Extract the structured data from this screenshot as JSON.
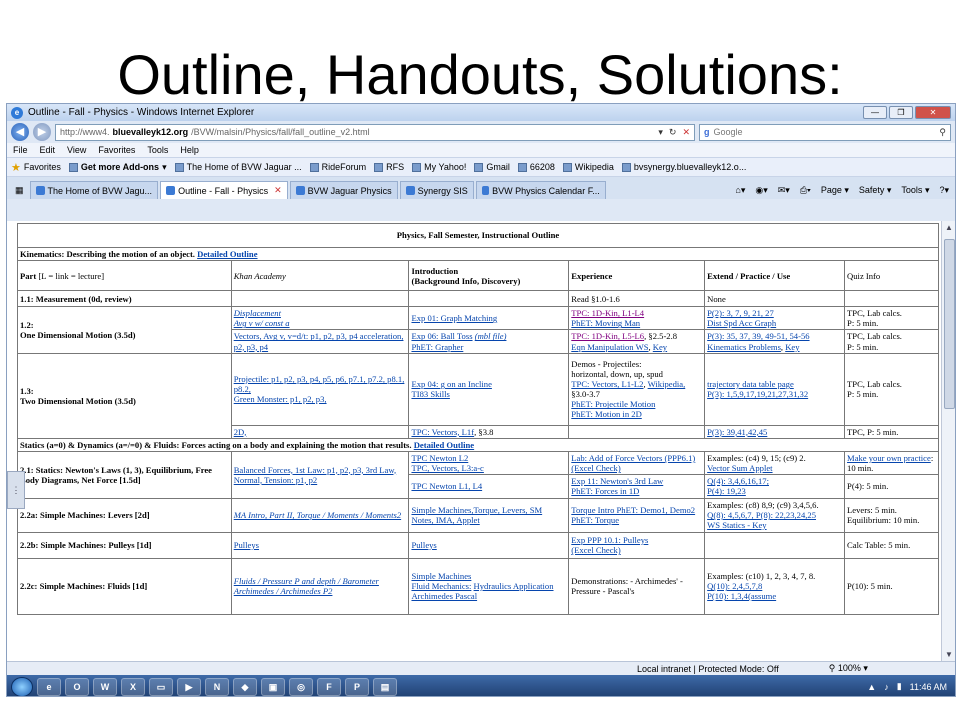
{
  "slide": {
    "title": "Outline, Handouts, Solutions:"
  },
  "window": {
    "title": "Outline - Fall - Physics - Windows Internet Explorer"
  },
  "address": {
    "url_prefix": "http://www4.",
    "url_domain": "bluevalleyk12.org",
    "url_path": "/BVW/malsin/Physics/fall/fall_outline_v2.html",
    "search_placeholder": "Google"
  },
  "menu": [
    "File",
    "Edit",
    "View",
    "Favorites",
    "Tools",
    "Help"
  ],
  "favorites": [
    "Favorites",
    "Get more Add-ons",
    "The Home of BVW Jaguar ...",
    "RideForum",
    "RFS",
    "My Yahoo!",
    "Gmail",
    "66208",
    "Wikipedia",
    "bvsynergy.bluevalleyk12.o..."
  ],
  "tabs": [
    "The Home of BVW Jagu...",
    "Outline - Fall - Physics",
    "BVW Jaguar Physics",
    "Synergy SIS",
    "BVW Physics Calendar F..."
  ],
  "toolbar": [
    "Page",
    "Safety",
    "Tools"
  ],
  "table": {
    "title": "Physics, Fall Semester, Instructional Outline",
    "kinematics_head": "Kinematics: Describing the motion of an object.",
    "detailed_outline": "Detailed Outline",
    "part": "Part",
    "part_note": "[L = link = lecture]",
    "khan": "Khan Academy",
    "intro": "Introduction",
    "intro_sub": "(Background Info, Discovery)",
    "experience": "Experience",
    "extend": "Extend / Practice / Use",
    "quiz": "Quiz Info",
    "r11_part": "1.1: Measurement (0d, review)",
    "r11_exp": "Read §1.0-1.6",
    "r11_ext": "None",
    "r12_part_a": "1.2:",
    "r12_part_b": "One Dimensional Motion (3.5d)",
    "r12_khan_1": "Displacement",
    "r12_khan_2": "Avg v w/ const a",
    "r12_intro_1": "Exp 01: Graph Matching",
    "r12_exp_1a": "TPC: 1D-Kin, L1-L4",
    "r12_exp_1b": "PhET: Moving Man",
    "r12_ext_1a": "P(2): 3, 7, 9, 21, 27",
    "r12_ext_1b": "Dist Spd Acc Graph",
    "r12_quiz_1a": "TPC, Lab calcs.",
    "r12_quiz_1b": "P: 5 min.",
    "r12_khan_3": "Vectors, Avg v, v=d/t: p1, p2, p3, p4 acceleration, p2, p3, p4",
    "r12_intro_2a": "Exp 06: Ball Toss",
    "r12_intro_2b": "(mbl file)",
    "r12_intro_2c": "PhET: Grapher",
    "r12_exp_2a": "TPC: 1D-Kin, L5-L6",
    "r12_exp_2b": ", §2.5-2.8",
    "r12_exp_2c": "Eqn Manipulation WS",
    "r12_exp_2d": "Key",
    "r12_ext_2a": "P(3): 35, 37, 39, 49-51, 54-56",
    "r12_ext_2b": "Kinematics Problems",
    "r12_ext_2c": "Key",
    "r12_quiz_2a": "TPC, Lab calcs.",
    "r12_quiz_2b": "P: 5 min.",
    "r13_part_a": "1.3:",
    "r13_part_b": "Two Dimensional Motion (3.5d)",
    "r13_khan_1a": "Projectile: p1, p2, p3, p4, p5, p6, p7.1, p7.2, p8.1, p8.2,",
    "r13_khan_1b": "Green Monster: p1, p2, p3,",
    "r13_intro_1a": "Exp 04: g on an Incline",
    "r13_intro_1b": "TI83 Skills",
    "r13_exp_1a": "Demos - Projectiles:",
    "r13_exp_1b": "horizontal, down, up, spud",
    "r13_exp_1c": "TPC: Vectors, L1-L2",
    "r13_exp_1d": "Wikipedia,",
    "r13_exp_1e": "§3.0-3.7",
    "r13_exp_1f": "PhET: Projectile Motion",
    "r13_exp_1g": "PhET: Motion in 2D",
    "r13_ext_1a": "trajectory data table page",
    "r13_ext_1b": "P(3): 1,5,9,17,19,21,27,31,32",
    "r13_quiz_1a": "TPC, Lab calcs.",
    "r13_quiz_1b": "P: 5 min.",
    "r13_khan_2": "2D,",
    "r13_intro_2a": "TPC: Vectors, L1f",
    "r13_intro_2b": ", §3.8",
    "r13_ext_2": "P(3): 39,41,42,45",
    "r13_quiz_2": "TPC, P: 5 min.",
    "statics_head": "Statics (a=0) & Dynamics (a=/=0) & Fluids: Forces acting on a body and explaining the motion that results.",
    "r21_part": "2.1: Statics: Newton's Laws (1, 3), Equilibrium, Free Body Diagrams, Net Force [1.5d]",
    "r21_khan": "Balanced Forces, 1st Law: p1, p2, p3, 3rd Law, Normal, Tension: p1, p2",
    "r21_intro_1a": "TPC Newton L2",
    "r21_intro_1b": "TPC, Vectors, L3:a-c",
    "r21_exp_1a": "Lab: Add of Force Vectors (PPP6.1)",
    "r21_exp_1b": "(Excel Check)",
    "r21_ext_1a": "Examples: (c4) 9, 15; (c9) 2.",
    "r21_ext_1b": "Vector Sum Applet",
    "r21_quiz_1a": "Make your own practice",
    "r21_quiz_1b": ": 10 min.",
    "r21_intro_2": "TPC Newton L1, L4",
    "r21_exp_2a": "Exp 11: Newton's 3rd Law",
    "r21_exp_2b": "PhET: Forces in 1D",
    "r21_ext_2a": "Q(4): 3,4,6,16,17;",
    "r21_ext_2b": "P(4): 19,23",
    "r21_quiz_2": "P(4): 5 min.",
    "r22a_part": "2.2a: Simple Machines: Levers [2d]",
    "r22a_khan": "MA Intro, Part II, Torque / Moments / Moments2",
    "r22a_intro": "Simple Machines,Torque, Levers, SM Notes, IMA, Applet",
    "r22a_exp": "Torque Intro PhET: Demo1, Demo2 PhET: Torque",
    "r22a_ext_1": "Examples: (c8) 8,9; (c9) 3,4,5,6.",
    "r22a_ext_2": "Q(8): 4,5,6,7, P(8): 22,23,24,25",
    "r22a_ext_3": "WS Statics - Key",
    "r22a_quiz": "Levers: 5 min. Equilibrium: 10 min.",
    "r22b_part": "2.2b: Simple Machines: Pulleys [1d]",
    "r22b_khan": "Pulleys",
    "r22b_intro": "Pulleys",
    "r22b_exp_1": "Exp PPP 10.1: Pulleys",
    "r22b_exp_2": "(Excel Check)",
    "r22b_quiz": "Calc Table: 5 min.",
    "r22c_part": "2.2c: Simple Machines: Fluids [1d]",
    "r22c_khan": "Fluids / Pressure P and depth / Barometer Archimedes / Archimedes P2",
    "r22c_intro_1": "Simple Machines",
    "r22c_intro_2": "Fluid Mechanics:",
    "r22c_intro_3": "Hydraulics Application Archimedes Pascal",
    "r22c_exp": "Demonstrations: - Archimedes' - Pressure - Pascal's",
    "r22c_ext_1": "Examples: (c10) 1, 2, 3, 4, 7, 8.",
    "r22c_ext_2": "Q(10): 2,4,5,7,8",
    "r22c_ext_3": "P(10): 1,3,4(assume",
    "r22c_quiz": "P(10): 5 min."
  },
  "status": {
    "zone": "Local intranet | Protected Mode: Off",
    "zoom": "100%"
  },
  "taskbar": {
    "clock": "11:46 AM"
  }
}
